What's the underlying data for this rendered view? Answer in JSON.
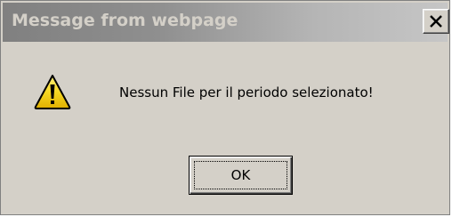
{
  "dialog": {
    "title": "Message from webpage",
    "close_icon": "close-x",
    "warning_icon": "warning-triangle-exclamation",
    "message": "Nessun File per il periodo selezionato!",
    "ok_label": "OK"
  },
  "colors": {
    "dialog_bg": "#d4d0c8",
    "titlebar_start": "#808080",
    "titlebar_end": "#c6c6c6",
    "title_text": "#d4d0c8",
    "warning_fill": "#f5d623"
  }
}
